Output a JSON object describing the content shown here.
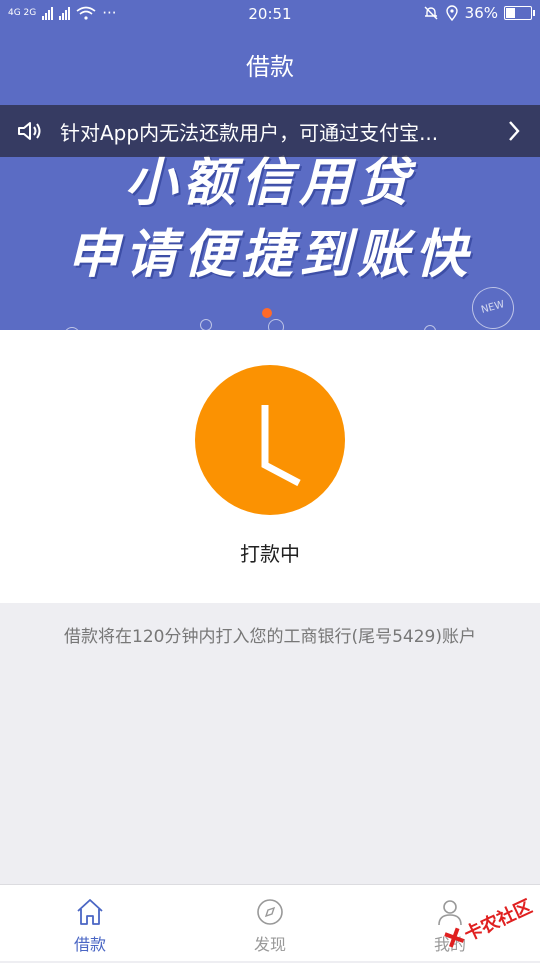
{
  "status_bar": {
    "left_text": "4G 2G",
    "time": "20:51",
    "battery": "36%",
    "battery_level": 0.36
  },
  "header": {
    "title": "借款"
  },
  "banner": {
    "line1": "小额信用贷",
    "line2": "申请便捷到账快",
    "badge": "NEW"
  },
  "notice": {
    "text": "针对App内无法还款用户，可通过支付宝..."
  },
  "loan_status": {
    "label": "打款中",
    "description": "借款将在120分钟内打入您的工商银行(尾号5429)账户"
  },
  "tabs": [
    {
      "label": "借款",
      "icon": "home-icon",
      "active": true
    },
    {
      "label": "发现",
      "icon": "compass-icon",
      "active": false
    },
    {
      "label": "我的",
      "icon": "user-icon",
      "active": false
    }
  ],
  "watermark": {
    "text": "卡农社区"
  },
  "colors": {
    "primary": "#5b6cc4",
    "accent_orange": "#fb9202",
    "tab_active": "#4a66c4",
    "indicator": "#ff6a2a"
  }
}
